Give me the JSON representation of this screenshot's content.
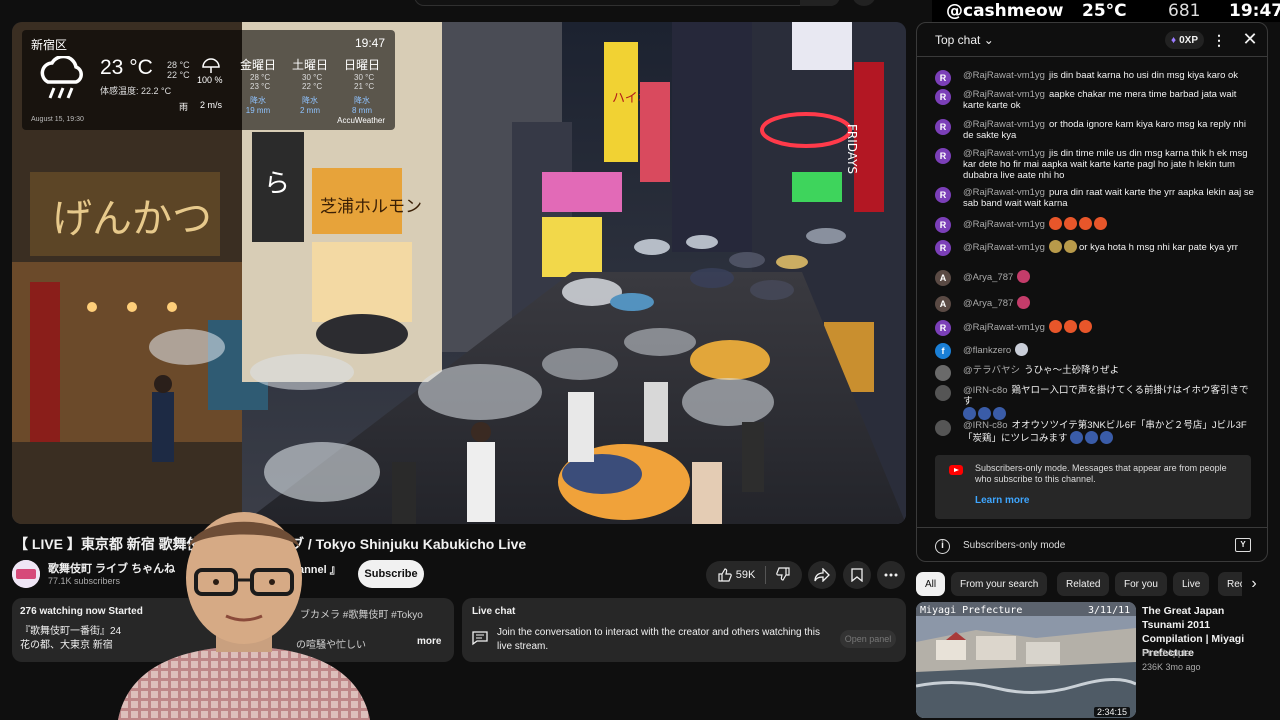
{
  "overlay": {
    "handle": "@cashmeow",
    "temp": "25°C",
    "count": "681",
    "time": "19:47"
  },
  "weather": {
    "location": "新宿区",
    "time": "19:47",
    "temp": "23 °C",
    "hi": "28 °C",
    "lo": "22 °C",
    "feels": "体感温度: 22.2 °C",
    "humidity": "100 %",
    "rain_label": "雨",
    "wind": "2 m/s",
    "days": [
      {
        "name": "金曜日",
        "hi": "28 °C",
        "lo": "23 °C",
        "precip": "降水",
        "mm": "19 mm"
      },
      {
        "name": "土曜日",
        "hi": "30 °C",
        "lo": "22 °C",
        "precip": "降水",
        "mm": "2 mm"
      },
      {
        "name": "日曜日",
        "hi": "30 °C",
        "lo": "21 °C",
        "precip": "降水",
        "mm": "8 mm"
      }
    ],
    "date": "August 15, 19:30",
    "brand": "AccuWeather"
  },
  "video": {
    "title": "【 LIVE 】東京都 新宿 歌舞伎",
    "title_tail": "ライブ / Tokyo Shinjuku Kabukicho Live",
    "channel": "歌舞伎町 ライブ ちゃんね",
    "channel_tail": "ve Channel 』",
    "subscribers": "77.1K subscribers",
    "subscribe_label": "Subscribe",
    "likes": "59K"
  },
  "description": {
    "line1": "276 watching now  Started",
    "tags": "ブカメラ #歌舞伎町 #Tokyo",
    "line2": "『歌舞伎町一番街』24",
    "line3": "花の都、大東京 新宿",
    "line3b": "の喧騒や忙しい",
    "more": "more"
  },
  "livechat_box": {
    "title": "Live chat",
    "text": "Join the conversation to interact with the creator and others watching this live stream.",
    "button": "Open panel"
  },
  "chat": {
    "header": "Top chat",
    "xp": "0XP",
    "messages": [
      {
        "author": "@RajRawat-vm1yg",
        "initial": "R",
        "color": "#7b3fb8",
        "text": "jis din baat karna ho usi din msg kiya karo ok"
      },
      {
        "author": "@RajRawat-vm1yg",
        "initial": "R",
        "color": "#7b3fb8",
        "text": "aapke chakar me mera time barbad jata wait karte karte ok"
      },
      {
        "author": "@RajRawat-vm1yg",
        "initial": "R",
        "color": "#7b3fb8",
        "text": "or thoda ignore kam kiya karo msg ka reply nhi de sakte kya"
      },
      {
        "author": "@RajRawat-vm1yg",
        "initial": "R",
        "color": "#7b3fb8",
        "text": "jis din time mile us din msg karna thik h ek msg kar dete ho fir mai aapka wait karte karte pagl ho jate h lekin tum dubabra live aate nhi ho"
      },
      {
        "author": "@RajRawat-vm1yg",
        "initial": "R",
        "color": "#7b3fb8",
        "text": "pura din raat wait karte the yrr aapka lekin aaj se sab band wait wait karna"
      },
      {
        "author": "@RajRawat-vm1yg",
        "initial": "R",
        "color": "#7b3fb8",
        "text": ""
      },
      {
        "author": "@RajRawat-vm1yg",
        "initial": "R",
        "color": "#7b3fb8",
        "text": "or      kya hota h msg nhi kar pate kya yrr"
      },
      {
        "author": "@Arya_787",
        "initial": "A",
        "color": "#5a4a44",
        "text": ""
      },
      {
        "author": "@Arya_787",
        "initial": "A",
        "color": "#5a4a44",
        "text": ""
      },
      {
        "author": "@RajRawat-vm1yg",
        "initial": "R",
        "color": "#7b3fb8",
        "text": ""
      },
      {
        "author": "@flankzero",
        "initial": "f",
        "color": "#1a7fd6",
        "text": ""
      },
      {
        "author": "@テラバヤシ",
        "initial": "",
        "color": "#6a6a6a",
        "text": "うひゃ～土砂降りぜよ"
      },
      {
        "author": "@IRN-c8o",
        "initial": "",
        "color": "#555555",
        "text": "鶏ヤロー入口で声を掛けてくる前掛けはイホウ客引きです"
      },
      {
        "author": "@IRN-c8o",
        "initial": "",
        "color": "#555555",
        "text": "オオウソツイテ第3NKビル6F「串かど２号店」Jビル3F「炭鶏」にツレコみます"
      }
    ],
    "notice": "Subscribers-only mode. Messages that appear are from people who subscribe to this channel.",
    "learn_more": "Learn more",
    "footer": "Subscribers-only mode"
  },
  "chips": [
    "All",
    "From your search",
    "Related",
    "For you",
    "Live",
    "Rec"
  ],
  "related": {
    "title": "The Great Japan Tsunami 2011 Compilation | Miyagi Prefecture",
    "channel": "Pined Apple",
    "meta": "236K  3mo ago",
    "duration": "2:34:15",
    "thumb_label": "Miyagi Prefecture",
    "thumb_date": "3/11/11"
  }
}
